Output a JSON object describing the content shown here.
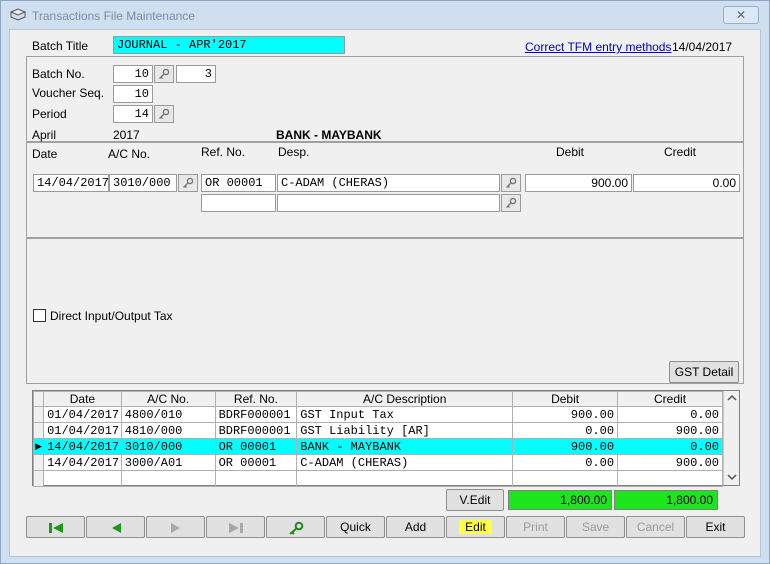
{
  "window": {
    "title": "Transactions File Maintenance",
    "close_glyph": "✕"
  },
  "header": {
    "batch_title_label": "Batch Title",
    "batch_title_value": "JOURNAL - APR'2017",
    "link_text": "Correct TFM entry methods",
    "date": "14/04/2017"
  },
  "batch": {
    "batch_no_label": "Batch No.",
    "batch_no_value": "10",
    "batch_no_extra": "3",
    "voucher_seq_label": "Voucher Seq.",
    "voucher_seq_value": "10",
    "period_label": "Period",
    "period_value": "14",
    "month": "April",
    "year": "2017",
    "account_name": "BANK - MAYBANK"
  },
  "entry": {
    "headers": {
      "date": "Date",
      "ac_no": "A/C No.",
      "ref_no": "Ref. No.",
      "desp": "Desp.",
      "debit": "Debit",
      "credit": "Credit"
    },
    "row": {
      "date": "14/04/2017",
      "ac_no": "3010/000",
      "ref_no": "OR 00001",
      "desp": "C-ADAM (CHERAS)",
      "debit": "900.00",
      "credit": "0.00"
    },
    "row2": {
      "ref_no": "",
      "desp": ""
    }
  },
  "direct_tax_label": "Direct Input/Output Tax",
  "gst_detail_label": "GST Detail",
  "grid": {
    "headers": [
      "Date",
      "A/C No.",
      "Ref. No.",
      "A/C Description",
      "Debit",
      "Credit"
    ],
    "rows": [
      {
        "date": "01/04/2017",
        "ac_no": "4800/010",
        "ref": "BDRF000001",
        "desc": "GST Input Tax",
        "debit": "900.00",
        "credit": "0.00",
        "selected": false
      },
      {
        "date": "01/04/2017",
        "ac_no": "4810/000",
        "ref": "BDRF000001",
        "desc": "GST Liability [AR]",
        "debit": "0.00",
        "credit": "900.00",
        "selected": false
      },
      {
        "date": "14/04/2017",
        "ac_no": "3010/000",
        "ref": "OR 00001",
        "desc": "BANK - MAYBANK",
        "debit": "900.00",
        "credit": "0.00",
        "selected": true
      },
      {
        "date": "14/04/2017",
        "ac_no": "3000/A01",
        "ref": "OR 00001",
        "desc": "C-ADAM (CHERAS)",
        "debit": "0.00",
        "credit": "900.00",
        "selected": false
      }
    ],
    "row_indicator": "▶"
  },
  "totals": {
    "vedit_label": "V.Edit",
    "debit": "1,800.00",
    "credit": "1,800.00"
  },
  "toolbar": {
    "quick": "Quick",
    "add": "Add",
    "edit": "Edit",
    "print": "Print",
    "save": "Save",
    "cancel": "Cancel",
    "exit": "Exit"
  },
  "colors": {
    "highlight_cyan": "#00ffff",
    "total_green": "#1de51d",
    "nav_green": "#1a9a1a",
    "edit_highlight": "#ffff44"
  }
}
